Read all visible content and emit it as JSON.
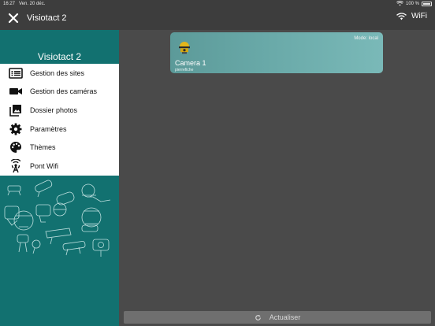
{
  "status_bar": {
    "time": "16:27",
    "date": "Ven. 20 déc.",
    "battery": "100 %"
  },
  "nav": {
    "title": "Visiotact 2",
    "wifi_label": "WiFi"
  },
  "sidebar": {
    "title": "Visiotact 2",
    "items": [
      {
        "label": "Gestion des sites",
        "icon": "list-icon"
      },
      {
        "label": "Gestion des caméras",
        "icon": "video-camera-icon"
      },
      {
        "label": "Dossier photos",
        "icon": "photos-icon"
      },
      {
        "label": "Paramètres",
        "icon": "gear-icon"
      },
      {
        "label": "Thèmes",
        "icon": "palette-icon"
      },
      {
        "label": "Pont Wifi",
        "icon": "antenna-icon"
      }
    ]
  },
  "camera_card": {
    "mode": "Mode: local",
    "name": "Camera 1",
    "subtitle": "pierrefiche"
  },
  "refresh": {
    "label": "Actualiser"
  },
  "colors": {
    "sidebar": "#127170",
    "background": "#4a4a4a",
    "card": "#69a9a8",
    "bar": "#3d3d3d"
  }
}
